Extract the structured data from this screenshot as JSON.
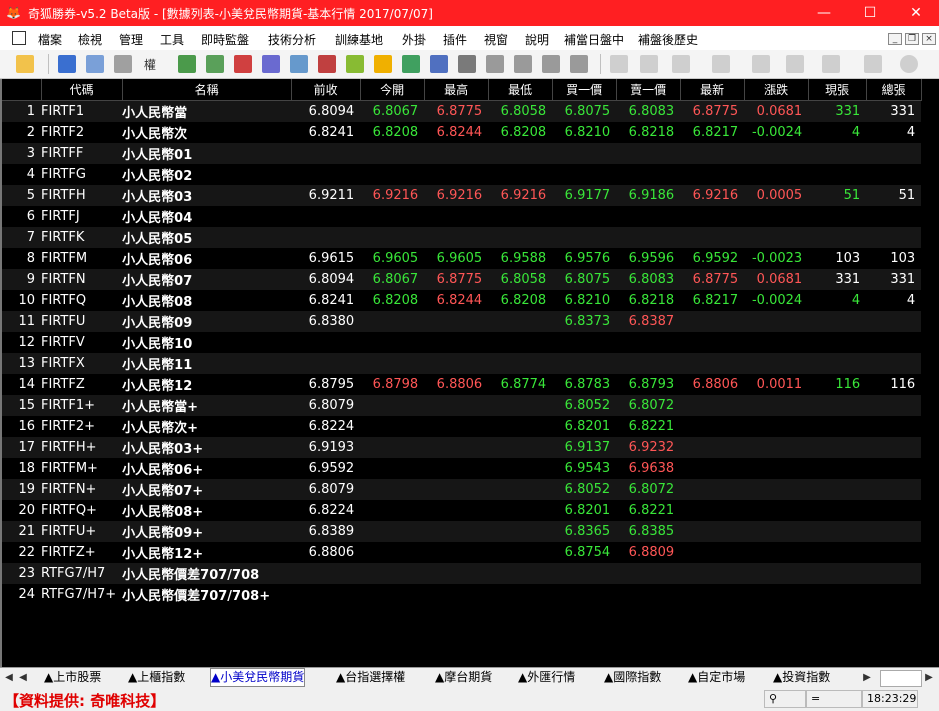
{
  "window": {
    "title": "奇狐勝券-v5.2 Beta版 - [數據列表-小美兌民幣期貨-基本行情 2017/07/07]",
    "minimize": "—",
    "maximize": "☐",
    "close": "✕"
  },
  "menu": [
    "檔案",
    "檢視",
    "管理",
    "工具",
    "即時監盤",
    "技術分析",
    "訓練基地",
    "外掛",
    "插件",
    "視窗",
    "說明",
    "補當日盤中",
    "補盤後歷史"
  ],
  "toolbar": {
    "label": "權"
  },
  "columns": [
    "",
    "代碼",
    "名稱",
    "前收",
    "今開",
    "最高",
    "最低",
    "買一價",
    "賣一價",
    "最新",
    "漲跌",
    "現張",
    "總張"
  ],
  "rows": [
    {
      "i": "1",
      "code": "FIRTF1",
      "name": "小人民幣當",
      "prev": "6.8094",
      "open": "6.8067",
      "high": "6.8775",
      "low": "6.8058",
      "bid": "6.8075",
      "ask": "6.8083",
      "last": "6.8775",
      "chg": "0.0681",
      "vol": "331",
      "tot": "331",
      "c": [
        "dn",
        "up",
        "dn",
        "dn",
        "dn",
        "up",
        "up",
        "dn"
      ]
    },
    {
      "i": "2",
      "code": "FIRTF2",
      "name": "小人民幣次",
      "prev": "6.8241",
      "open": "6.8208",
      "high": "6.8244",
      "low": "6.8208",
      "bid": "6.8210",
      "ask": "6.8218",
      "last": "6.8217",
      "chg": "-0.0024",
      "vol": "4",
      "tot": "4",
      "c": [
        "dn",
        "up",
        "dn",
        "dn",
        "dn",
        "dn",
        "dn",
        "dn"
      ]
    },
    {
      "i": "3",
      "code": "FIRTFF",
      "name": "小人民幣01",
      "prev": "",
      "open": "",
      "high": "",
      "low": "",
      "bid": "",
      "ask": "",
      "last": "",
      "chg": "",
      "vol": "",
      "tot": "",
      "c": [
        "",
        "",
        "",
        "",
        "",
        "",
        "",
        ""
      ]
    },
    {
      "i": "4",
      "code": "FIRTFG",
      "name": "小人民幣02",
      "prev": "",
      "open": "",
      "high": "",
      "low": "",
      "bid": "",
      "ask": "",
      "last": "",
      "chg": "",
      "vol": "",
      "tot": "",
      "c": [
        "",
        "",
        "",
        "",
        "",
        "",
        "",
        ""
      ]
    },
    {
      "i": "5",
      "code": "FIRTFH",
      "name": "小人民幣03",
      "prev": "6.9211",
      "open": "6.9216",
      "high": "6.9216",
      "low": "6.9216",
      "bid": "6.9177",
      "ask": "6.9186",
      "last": "6.9216",
      "chg": "0.0005",
      "vol": "51",
      "tot": "51",
      "c": [
        "up",
        "up",
        "up",
        "dn",
        "dn",
        "up",
        "up",
        "dn"
      ]
    },
    {
      "i": "6",
      "code": "FIRTFJ",
      "name": "小人民幣04",
      "prev": "",
      "open": "",
      "high": "",
      "low": "",
      "bid": "",
      "ask": "",
      "last": "",
      "chg": "",
      "vol": "",
      "tot": "",
      "c": [
        "",
        "",
        "",
        "",
        "",
        "",
        "",
        ""
      ]
    },
    {
      "i": "7",
      "code": "FIRTFK",
      "name": "小人民幣05",
      "prev": "",
      "open": "",
      "high": "",
      "low": "",
      "bid": "",
      "ask": "",
      "last": "",
      "chg": "",
      "vol": "",
      "tot": "",
      "c": [
        "",
        "",
        "",
        "",
        "",
        "",
        "",
        ""
      ]
    },
    {
      "i": "8",
      "code": "FIRTFM",
      "name": "小人民幣06",
      "prev": "6.9615",
      "open": "6.9605",
      "high": "6.9605",
      "low": "6.9588",
      "bid": "6.9576",
      "ask": "6.9596",
      "last": "6.9592",
      "chg": "-0.0023",
      "vol": "103",
      "tot": "103",
      "c": [
        "dn",
        "dn",
        "dn",
        "dn",
        "dn",
        "dn",
        "dn",
        "wh"
      ]
    },
    {
      "i": "9",
      "code": "FIRTFN",
      "name": "小人民幣07",
      "prev": "6.8094",
      "open": "6.8067",
      "high": "6.8775",
      "low": "6.8058",
      "bid": "6.8075",
      "ask": "6.8083",
      "last": "6.8775",
      "chg": "0.0681",
      "vol": "331",
      "tot": "331",
      "c": [
        "dn",
        "up",
        "dn",
        "dn",
        "dn",
        "up",
        "up",
        "wh"
      ]
    },
    {
      "i": "10",
      "code": "FIRTFQ",
      "name": "小人民幣08",
      "prev": "6.8241",
      "open": "6.8208",
      "high": "6.8244",
      "low": "6.8208",
      "bid": "6.8210",
      "ask": "6.8218",
      "last": "6.8217",
      "chg": "-0.0024",
      "vol": "4",
      "tot": "4",
      "c": [
        "dn",
        "up",
        "dn",
        "dn",
        "dn",
        "dn",
        "dn",
        "dn"
      ]
    },
    {
      "i": "11",
      "code": "FIRTFU",
      "name": "小人民幣09",
      "prev": "6.8380",
      "open": "",
      "high": "",
      "low": "",
      "bid": "6.8373",
      "ask": "6.8387",
      "last": "",
      "chg": "",
      "vol": "",
      "tot": "",
      "c": [
        "",
        "",
        "",
        "dn",
        "up",
        "",
        "",
        ""
      ]
    },
    {
      "i": "12",
      "code": "FIRTFV",
      "name": "小人民幣10",
      "prev": "",
      "open": "",
      "high": "",
      "low": "",
      "bid": "",
      "ask": "",
      "last": "",
      "chg": "",
      "vol": "",
      "tot": "",
      "c": [
        "",
        "",
        "",
        "",
        "",
        "",
        "",
        ""
      ]
    },
    {
      "i": "13",
      "code": "FIRTFX",
      "name": "小人民幣11",
      "prev": "",
      "open": "",
      "high": "",
      "low": "",
      "bid": "",
      "ask": "",
      "last": "",
      "chg": "",
      "vol": "",
      "tot": "",
      "c": [
        "",
        "",
        "",
        "",
        "",
        "",
        "",
        ""
      ]
    },
    {
      "i": "14",
      "code": "FIRTFZ",
      "name": "小人民幣12",
      "prev": "6.8795",
      "open": "6.8798",
      "high": "6.8806",
      "low": "6.8774",
      "bid": "6.8783",
      "ask": "6.8793",
      "last": "6.8806",
      "chg": "0.0011",
      "vol": "116",
      "tot": "116",
      "c": [
        "up",
        "up",
        "dn",
        "dn",
        "dn",
        "up",
        "up",
        "dn"
      ]
    },
    {
      "i": "15",
      "code": "FIRTF1+",
      "name": "小人民幣當+",
      "prev": "6.8079",
      "open": "",
      "high": "",
      "low": "",
      "bid": "6.8052",
      "ask": "6.8072",
      "last": "",
      "chg": "",
      "vol": "",
      "tot": "",
      "c": [
        "",
        "",
        "",
        "dn",
        "dn",
        "",
        "",
        ""
      ]
    },
    {
      "i": "16",
      "code": "FIRTF2+",
      "name": "小人民幣次+",
      "prev": "6.8224",
      "open": "",
      "high": "",
      "low": "",
      "bid": "6.8201",
      "ask": "6.8221",
      "last": "",
      "chg": "",
      "vol": "",
      "tot": "",
      "c": [
        "",
        "",
        "",
        "dn",
        "dn",
        "",
        "",
        ""
      ]
    },
    {
      "i": "17",
      "code": "FIRTFH+",
      "name": "小人民幣03+",
      "prev": "6.9193",
      "open": "",
      "high": "",
      "low": "",
      "bid": "6.9137",
      "ask": "6.9232",
      "last": "",
      "chg": "",
      "vol": "",
      "tot": "",
      "c": [
        "",
        "",
        "",
        "dn",
        "up",
        "",
        "",
        ""
      ]
    },
    {
      "i": "18",
      "code": "FIRTFM+",
      "name": "小人民幣06+",
      "prev": "6.9592",
      "open": "",
      "high": "",
      "low": "",
      "bid": "6.9543",
      "ask": "6.9638",
      "last": "",
      "chg": "",
      "vol": "",
      "tot": "",
      "c": [
        "",
        "",
        "",
        "dn",
        "up",
        "",
        "",
        ""
      ]
    },
    {
      "i": "19",
      "code": "FIRTFN+",
      "name": "小人民幣07+",
      "prev": "6.8079",
      "open": "",
      "high": "",
      "low": "",
      "bid": "6.8052",
      "ask": "6.8072",
      "last": "",
      "chg": "",
      "vol": "",
      "tot": "",
      "c": [
        "",
        "",
        "",
        "dn",
        "dn",
        "",
        "",
        ""
      ]
    },
    {
      "i": "20",
      "code": "FIRTFQ+",
      "name": "小人民幣08+",
      "prev": "6.8224",
      "open": "",
      "high": "",
      "low": "",
      "bid": "6.8201",
      "ask": "6.8221",
      "last": "",
      "chg": "",
      "vol": "",
      "tot": "",
      "c": [
        "",
        "",
        "",
        "dn",
        "dn",
        "",
        "",
        ""
      ]
    },
    {
      "i": "21",
      "code": "FIRTFU+",
      "name": "小人民幣09+",
      "prev": "6.8389",
      "open": "",
      "high": "",
      "low": "",
      "bid": "6.8365",
      "ask": "6.8385",
      "last": "",
      "chg": "",
      "vol": "",
      "tot": "",
      "c": [
        "",
        "",
        "",
        "dn",
        "dn",
        "",
        "",
        ""
      ]
    },
    {
      "i": "22",
      "code": "FIRTFZ+",
      "name": "小人民幣12+",
      "prev": "6.8806",
      "open": "",
      "high": "",
      "low": "",
      "bid": "6.8754",
      "ask": "6.8809",
      "last": "",
      "chg": "",
      "vol": "",
      "tot": "",
      "c": [
        "",
        "",
        "",
        "dn",
        "up",
        "",
        "",
        ""
      ]
    },
    {
      "i": "23",
      "code": "RTFG7/H7",
      "name": "小人民幣價差707/708",
      "prev": "",
      "open": "",
      "high": "",
      "low": "",
      "bid": "",
      "ask": "",
      "last": "",
      "chg": "",
      "vol": "",
      "tot": "",
      "c": [
        "",
        "",
        "",
        "",
        "",
        "",
        "",
        ""
      ]
    },
    {
      "i": "24",
      "code": "RTFG7/H7+",
      "name": "小人民幣價差707/708+",
      "prev": "",
      "open": "",
      "high": "",
      "low": "",
      "bid": "",
      "ask": "",
      "last": "",
      "chg": "",
      "vol": "",
      "tot": "",
      "c": [
        "",
        "",
        "",
        "",
        "",
        "",
        "",
        ""
      ]
    }
  ],
  "tabs": [
    "▲上市股票",
    "▲上櫃指數",
    "▲小美兌民幣期貨",
    "▲台指選擇權",
    "▲摩台期貨",
    "▲外匯行情",
    "▲國際指數",
    "▲自定市場",
    "▲投資指數"
  ],
  "active_tab": 2,
  "status": {
    "provider": "【資料提供: 奇唯科技】",
    "indicator": "=",
    "time": "18:23:29"
  },
  "colors": {
    "up": "#ff5656",
    "down": "#39e639",
    "name": "#ffd21f",
    "code": "#c7c7ff",
    "title_bg": "#ff1f22"
  }
}
